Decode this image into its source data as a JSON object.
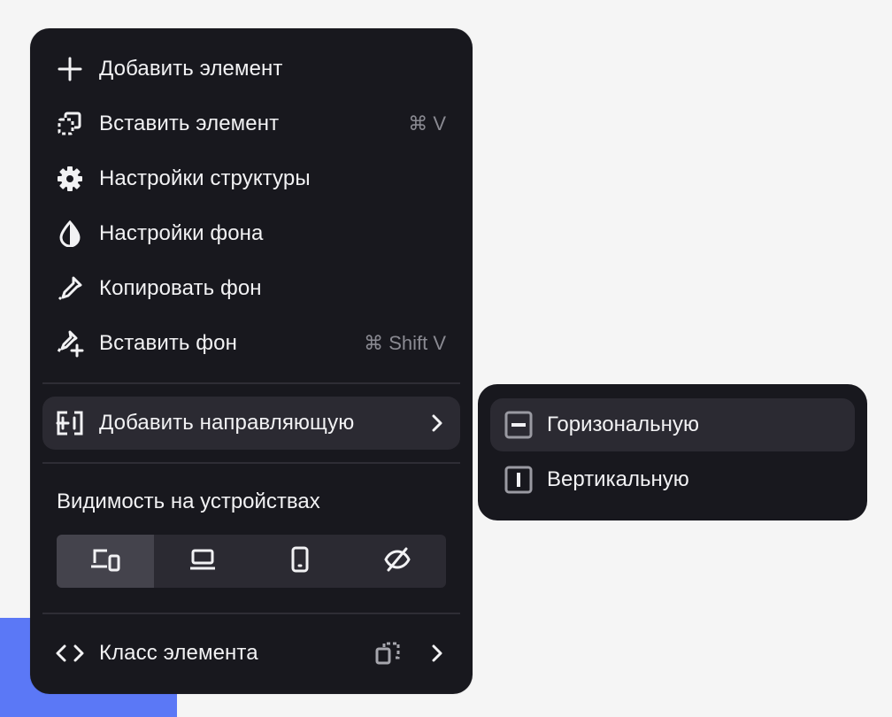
{
  "menu": {
    "items": [
      {
        "label": "Добавить элемент",
        "icon": "plus-icon"
      },
      {
        "label": "Вставить элемент",
        "icon": "paste-element-icon",
        "shortcut": "⌘ V"
      },
      {
        "label": "Настройки структуры",
        "icon": "gear-icon"
      },
      {
        "label": "Настройки фона",
        "icon": "drop-icon"
      },
      {
        "label": "Копировать фон",
        "icon": "dropper-icon"
      },
      {
        "label": "Вставить фон",
        "icon": "dropper-plus-icon",
        "shortcut": "⌘ Shift V"
      },
      {
        "label": "Добавить направляющую",
        "icon": "add-guide-icon",
        "has_submenu": true
      }
    ],
    "visibility": {
      "title": "Видимость на устройствах",
      "options": [
        {
          "icon": "all-devices-icon",
          "selected": true
        },
        {
          "icon": "laptop-icon",
          "selected": false
        },
        {
          "icon": "phone-icon",
          "selected": false
        },
        {
          "icon": "eye-off-icon",
          "selected": false
        }
      ]
    },
    "class_item": {
      "label": "Класс элемента",
      "icon": "code-icon",
      "extra_icon": "copy-class-icon"
    }
  },
  "submenu": {
    "items": [
      {
        "label": "Горизональную",
        "icon": "horizontal-guide-icon"
      },
      {
        "label": "Вертикальную",
        "icon": "vertical-guide-icon"
      }
    ]
  },
  "colors": {
    "menu_bg": "#18181e",
    "hover_bg": "#2b2a32",
    "accent_blue": "#5b78f6",
    "text": "#f2f2f4",
    "muted": "#8a8a92"
  }
}
